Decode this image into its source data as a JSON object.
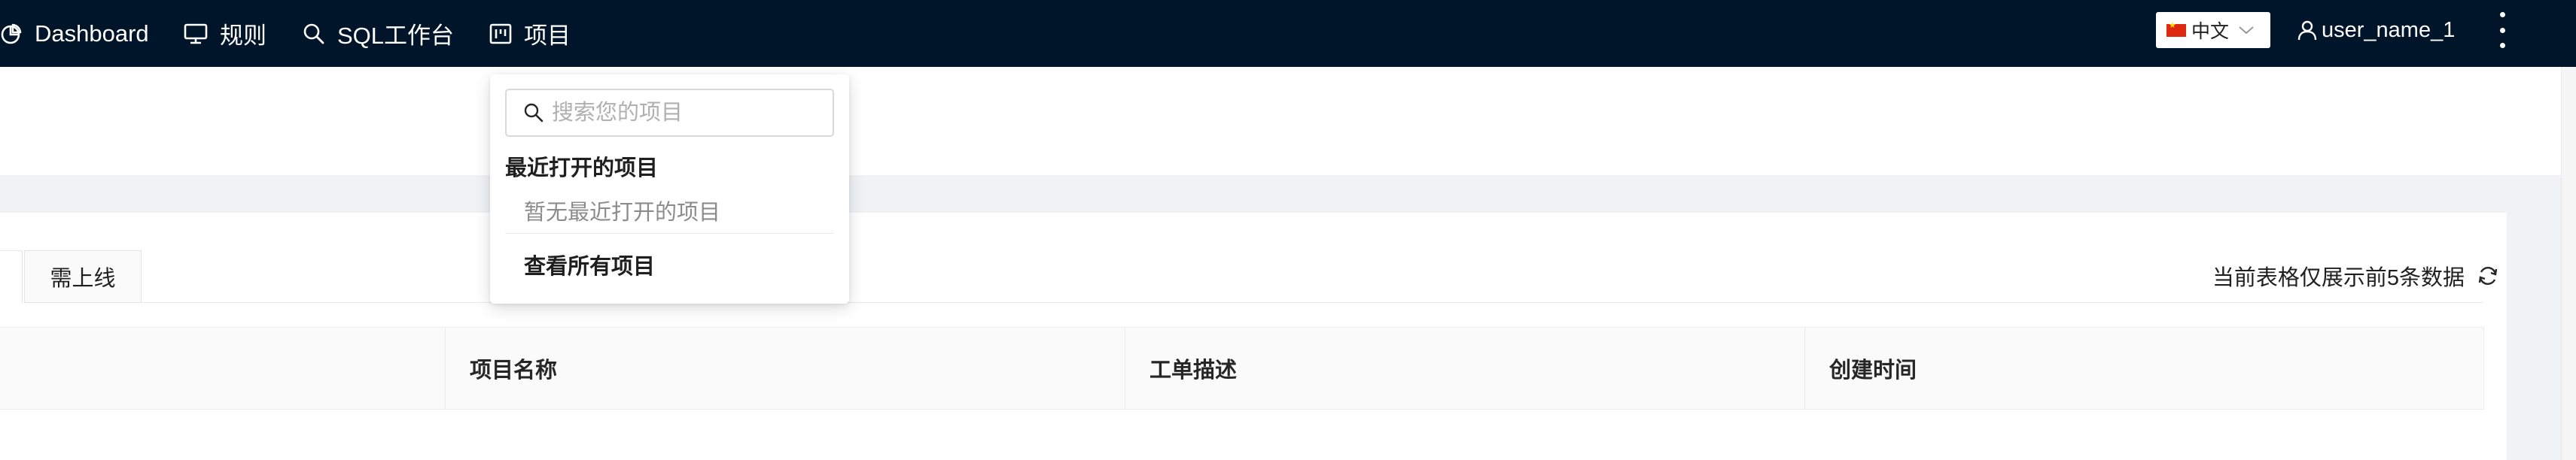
{
  "nav": {
    "items": [
      {
        "label": "Dashboard",
        "icon": "pie-chart-icon"
      },
      {
        "label": "规则",
        "icon": "monitor-icon"
      },
      {
        "label": "SQL工作台",
        "icon": "search-icon"
      },
      {
        "label": "项目",
        "icon": "project-board-icon"
      }
    ],
    "language": {
      "label": "中文",
      "flag": "china-flag-icon"
    },
    "user": {
      "name": "user_name_1",
      "icon": "user-icon"
    },
    "more_icon": "more-vertical-icon",
    "colors": {
      "bar": "#001529",
      "text": "#ffffff"
    }
  },
  "project_dropdown": {
    "search_placeholder": "搜索您的项目",
    "search_value": "",
    "recent_title": "最近打开的项目",
    "recent_empty": "暂无最近打开的项目",
    "view_all": "查看所有项目"
  },
  "tabs": [
    {
      "label": "需上线",
      "active": false
    }
  ],
  "table": {
    "notice": "当前表格仅展示前5条数据",
    "refresh_icon": "refresh-icon",
    "columns": [
      "",
      "项目名称",
      "工单描述",
      "创建时间"
    ]
  }
}
